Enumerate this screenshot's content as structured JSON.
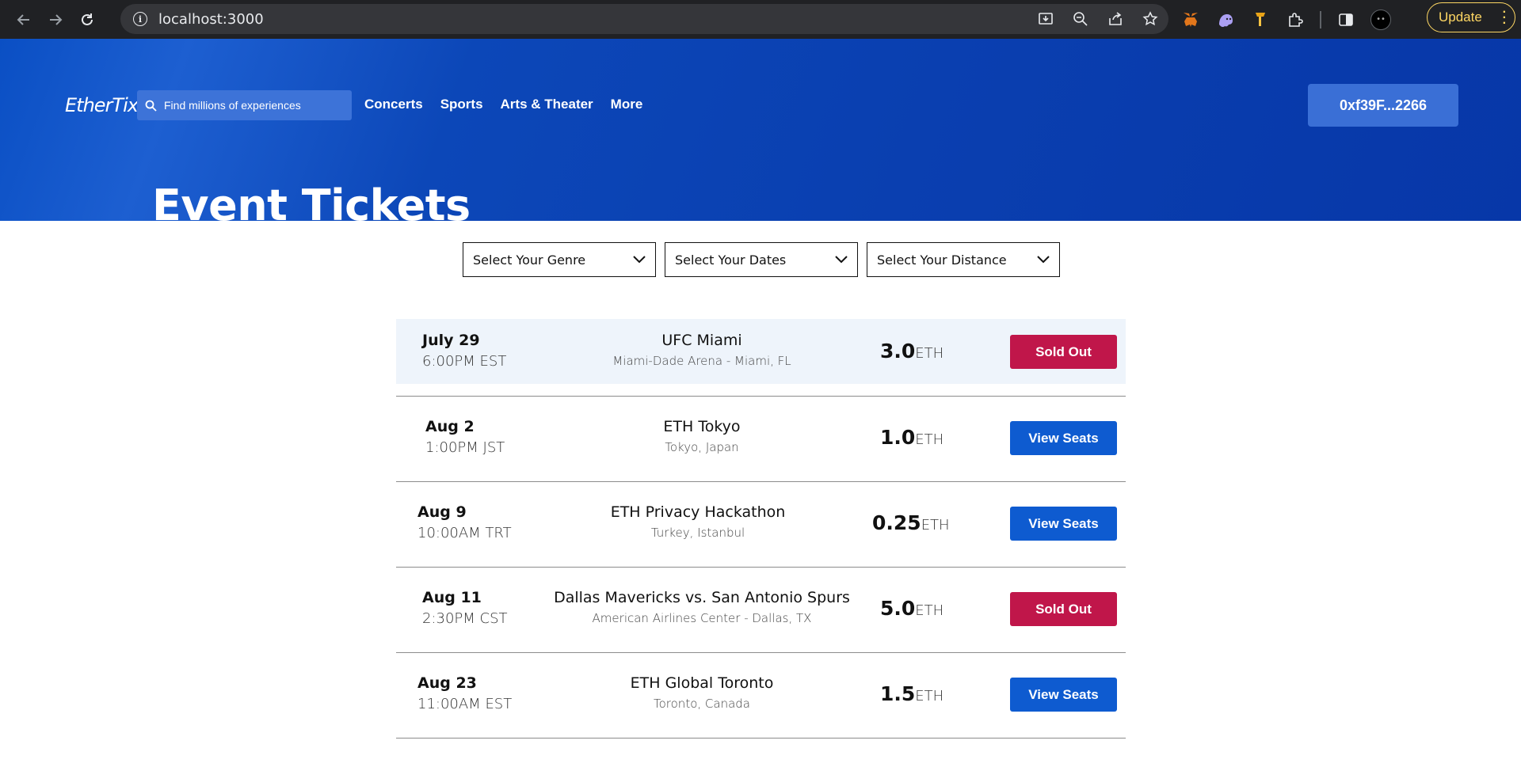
{
  "browser": {
    "url": "localhost:3000",
    "update_label": "Update"
  },
  "header": {
    "logo": "EtherTix",
    "search_placeholder": "Find millions of experiences",
    "nav": [
      "Concerts",
      "Sports",
      "Arts & Theater",
      "More"
    ],
    "wallet": "0xf39F...2266",
    "title": "Event Tickets"
  },
  "filters": [
    "Select Your Genre",
    "Select Your Dates",
    "Select Your Distance"
  ],
  "events": [
    {
      "date": "July 29",
      "time": "6:00PM EST",
      "name": "UFC Miami",
      "venue": "Miami-Dade Arena - Miami, FL",
      "price": "3.0",
      "currency": "ETH",
      "action": "Sold Out",
      "status": "sold"
    },
    {
      "date": "Aug 2",
      "time": "1:00PM JST",
      "name": "ETH Tokyo",
      "venue": "Tokyo, Japan",
      "price": "1.0",
      "currency": "ETH",
      "action": "View Seats",
      "status": "view"
    },
    {
      "date": "Aug 9",
      "time": "10:00AM TRT",
      "name": "ETH Privacy Hackathon",
      "venue": "Turkey, Istanbul",
      "price": "0.25",
      "currency": "ETH",
      "action": "View Seats",
      "status": "view"
    },
    {
      "date": "Aug 11",
      "time": "2:30PM CST",
      "name": "Dallas Mavericks vs. San Antonio Spurs",
      "venue": "American Airlines Center - Dallas, TX",
      "price": "5.0",
      "currency": "ETH",
      "action": "Sold Out",
      "status": "sold"
    },
    {
      "date": "Aug 23",
      "time": "11:00AM EST",
      "name": "ETH Global Toronto",
      "venue": "Toronto, Canada",
      "price": "1.5",
      "currency": "ETH",
      "action": "View Seats",
      "status": "view"
    }
  ],
  "colors": {
    "hero_blue": "#0a3fb0",
    "sold_out_red": "#c0164a",
    "view_seats_blue": "#0e5bd0",
    "highlight_row": "#eef4fb"
  }
}
